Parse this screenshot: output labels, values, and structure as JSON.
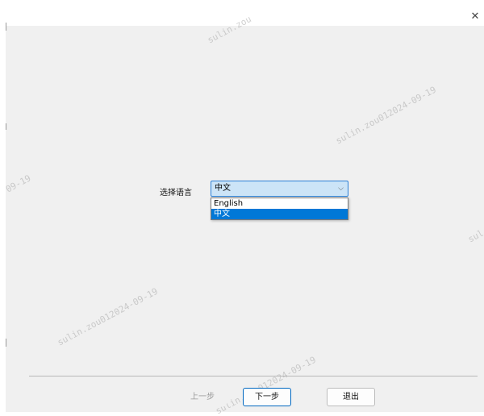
{
  "window": {
    "close_icon": "close-icon",
    "close_glyph": "✕"
  },
  "language": {
    "label": "选择语言",
    "selected": "中文",
    "chevron": "⌵",
    "options": [
      "English",
      "中文"
    ]
  },
  "nav": {
    "back_label": "上一步",
    "next_label": "下一步",
    "exit_label": "退出"
  },
  "watermarks": [
    "sulin.zou",
    "sulin.zou012024-09-19",
    "sulin.zou012024-09-19",
    "09-19",
    "sulin.zou012024-09-19",
    "sul",
    "sulin.zou012024-09-19"
  ],
  "colors": {
    "accent": "#0078d7",
    "select_bg": "#cce4f7",
    "panel_bg": "#f0f0f0"
  }
}
